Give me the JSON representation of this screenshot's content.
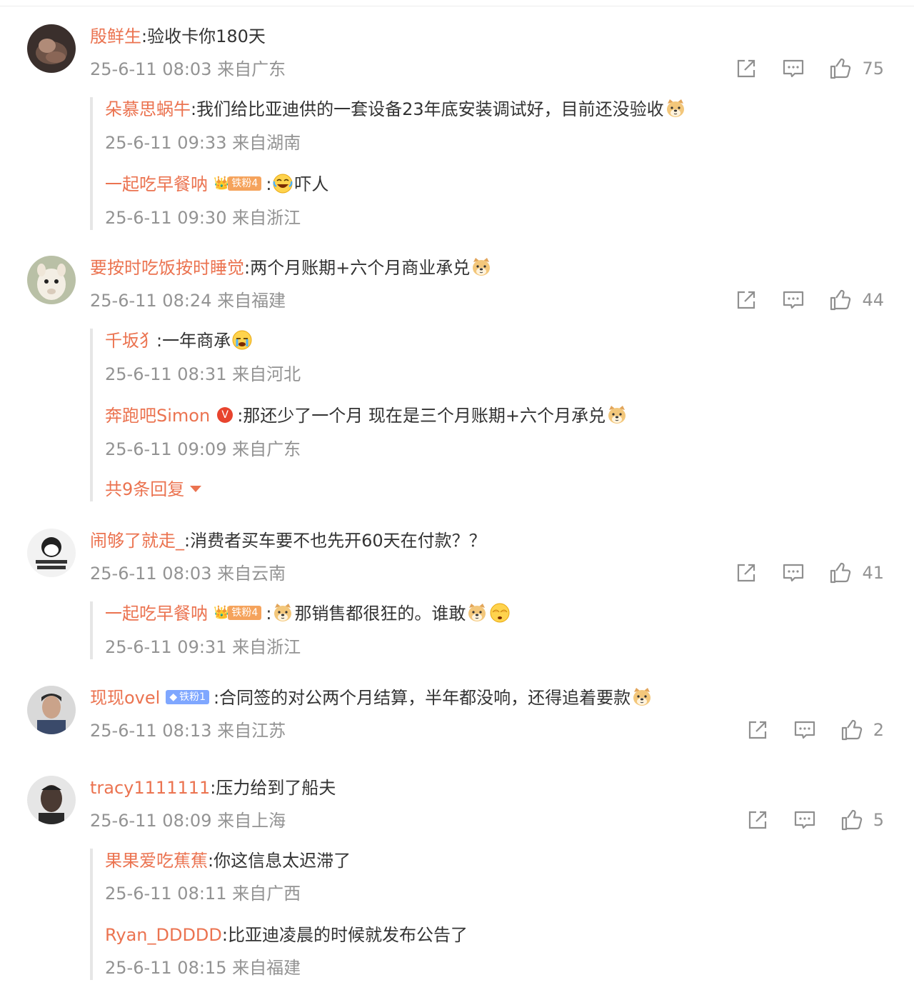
{
  "comments": [
    {
      "user": "殷鲜生",
      "text": ":验收卡你180天",
      "meta": "25-6-11 08:03 来自广东",
      "likes": "75",
      "replies": [
        {
          "user": "朵慕思蜗牛",
          "text": ":我们给比亚迪供的一套设备23年底安装调试好，目前还没验收",
          "meta": "25-6-11 09:33 来自湖南"
        },
        {
          "user": "一起吃早餐呐",
          "badge": "铁粉4",
          "text": ":",
          "text2": "吓人",
          "meta": "25-6-11 09:30 来自浙江"
        }
      ]
    },
    {
      "user": "要按时吃饭按时睡觉",
      "text": ":两个月账期+六个月商业承兑",
      "meta": "25-6-11 08:24 来自福建",
      "likes": "44",
      "replies": [
        {
          "user": "千坂犭",
          "text": ":一年商承",
          "meta": "25-6-11 08:31 来自河北"
        },
        {
          "user": "奔跑吧Simon",
          "text": ":那还少了一个月 现在是三个月账期+六个月承兑",
          "meta": "25-6-11 09:09 来自广东"
        }
      ],
      "more_replies": "共9条回复"
    },
    {
      "user": "闹够了就走_",
      "text": ":消费者买车要不也先开60天在付款？？",
      "meta": "25-6-11 08:03 来自云南",
      "likes": "41",
      "replies": [
        {
          "user": "一起吃早餐呐",
          "badge": "铁粉4",
          "text": ":",
          "text2": "那销售都很狂的。谁敢",
          "meta": "25-6-11 09:31 来自浙江"
        }
      ]
    },
    {
      "user": "现现ovel",
      "badge": "铁粉1",
      "text": ":合同签的对公两个月结算，半年都没响，还得追着要款",
      "meta": "25-6-11 08:13 来自江苏",
      "likes": "2"
    },
    {
      "user": "tracy1111111",
      "text": ":压力给到了船夫",
      "meta": "25-6-11 08:09 来自上海",
      "likes": "5",
      "replies": [
        {
          "user": "果果爱吃蕉蕉",
          "text": ":你这信息太迟滞了",
          "meta": "25-6-11 08:11 来自广西"
        },
        {
          "user": "Ryan_DDDDD",
          "text": ":比亚迪凌晨的时候就发布公告了",
          "meta": "25-6-11 08:15 来自福建"
        }
      ]
    }
  ],
  "colors": {
    "username": "#eb7350",
    "meta": "#939393",
    "text": "#333333",
    "divider": "#e6e6e6"
  },
  "icons": {
    "forward": "share-icon",
    "comment": "comment-icon",
    "like": "thumbs-up-icon",
    "verified": "v-badge-icon",
    "expand": "triangle-down-icon"
  }
}
